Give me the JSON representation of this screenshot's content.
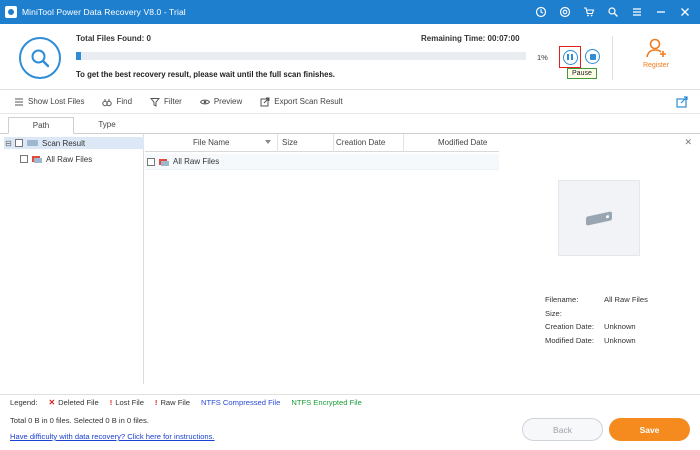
{
  "window": {
    "title": "MiniTool Power Data Recovery V8.0 - Trial",
    "controls": [
      "clock",
      "support",
      "cart",
      "search",
      "menu",
      "minimize",
      "close"
    ]
  },
  "header": {
    "total_files_label": "Total Files Found:  0",
    "remaining_time_label": "Remaining Time:  00:07:00",
    "progress_percent": 1,
    "progress_text": "1%",
    "hint": "To get the best recovery result, please wait until the full scan finishes.",
    "tooltip": "Pause",
    "register_label": "Register",
    "accent": "#2f8dd6",
    "register_color": "#f07b1d"
  },
  "toolbar": {
    "show_lost_files": "Show Lost Files",
    "find": "Find",
    "filter": "Filter",
    "preview": "Preview",
    "export": "Export Scan Result"
  },
  "tabs": [
    {
      "label": "Path",
      "active": true
    },
    {
      "label": "Type",
      "active": false
    }
  ],
  "tree": {
    "root": "Scan Result",
    "child": "All Raw Files"
  },
  "file_list": {
    "columns": [
      "File Name",
      "Size",
      "Creation Date",
      "Modified Date"
    ],
    "rows": [
      {
        "name": "All Raw Files"
      }
    ]
  },
  "preview": {
    "meta": [
      {
        "key": "Filename:",
        "value": "All Raw Files"
      },
      {
        "key": "Size:",
        "value": ""
      },
      {
        "key": "Creation Date:",
        "value": "Unknown"
      },
      {
        "key": "Modified Date:",
        "value": "Unknown"
      }
    ]
  },
  "legend": {
    "title": "Legend:",
    "deleted": "Deleted File",
    "lost": "Lost File",
    "raw": "Raw File",
    "ntfs_compressed": "NTFS Compressed File",
    "ntfs_encrypted": "NTFS Encrypted File"
  },
  "footer": {
    "totals": "Total 0 B in 0 files.  Selected 0 B in 0 files.",
    "help_link": "Have difficulty with data recovery? Click here for instructions.",
    "back": "Back",
    "save": "Save",
    "save_color": "#f58a1f"
  }
}
